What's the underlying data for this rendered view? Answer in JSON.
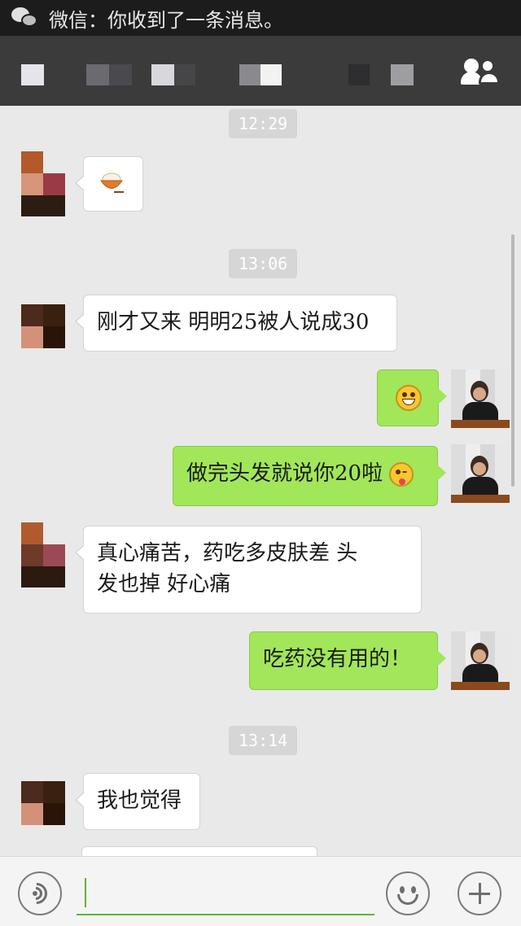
{
  "status_bar": {
    "notification_text": "微信：你收到了一条消息。",
    "icon": "wechat-icon"
  },
  "header": {
    "title_mosaic": "pixelated-contact-name",
    "contacts_icon": "group-contacts-icon"
  },
  "messages": [
    {
      "type": "time",
      "text": "12:29"
    },
    {
      "type": "incoming",
      "kind": "emoji",
      "emoji": "rice-bowl-emoji"
    },
    {
      "type": "time",
      "text": "13:06"
    },
    {
      "type": "incoming",
      "text": "刚才又来 明明25被人说成30"
    },
    {
      "type": "outgoing",
      "kind": "emoji",
      "emoji": "grin-emoji"
    },
    {
      "type": "outgoing",
      "text": "做完头发就说你20啦",
      "trailing_emoji": "wink-tongue-emoji"
    },
    {
      "type": "incoming",
      "text_line1": "真心痛苦，药吃多皮肤差 头",
      "text_line2": "发也掉 好心痛"
    },
    {
      "type": "outgoing",
      "text": "吃药没有用的！"
    },
    {
      "type": "time",
      "text": "13:14"
    },
    {
      "type": "incoming",
      "text": "我也觉得"
    }
  ],
  "input_bar": {
    "voice_icon": "voice-input-icon",
    "text_value": "",
    "emoji_icon": "emoji-icon",
    "plus_icon": "plus-icon"
  },
  "colors": {
    "outgoing_bubble": "#a2e65a",
    "incoming_bubble": "#ffffff",
    "header_bg": "#3b3b3b",
    "accent": "#5fb336"
  }
}
